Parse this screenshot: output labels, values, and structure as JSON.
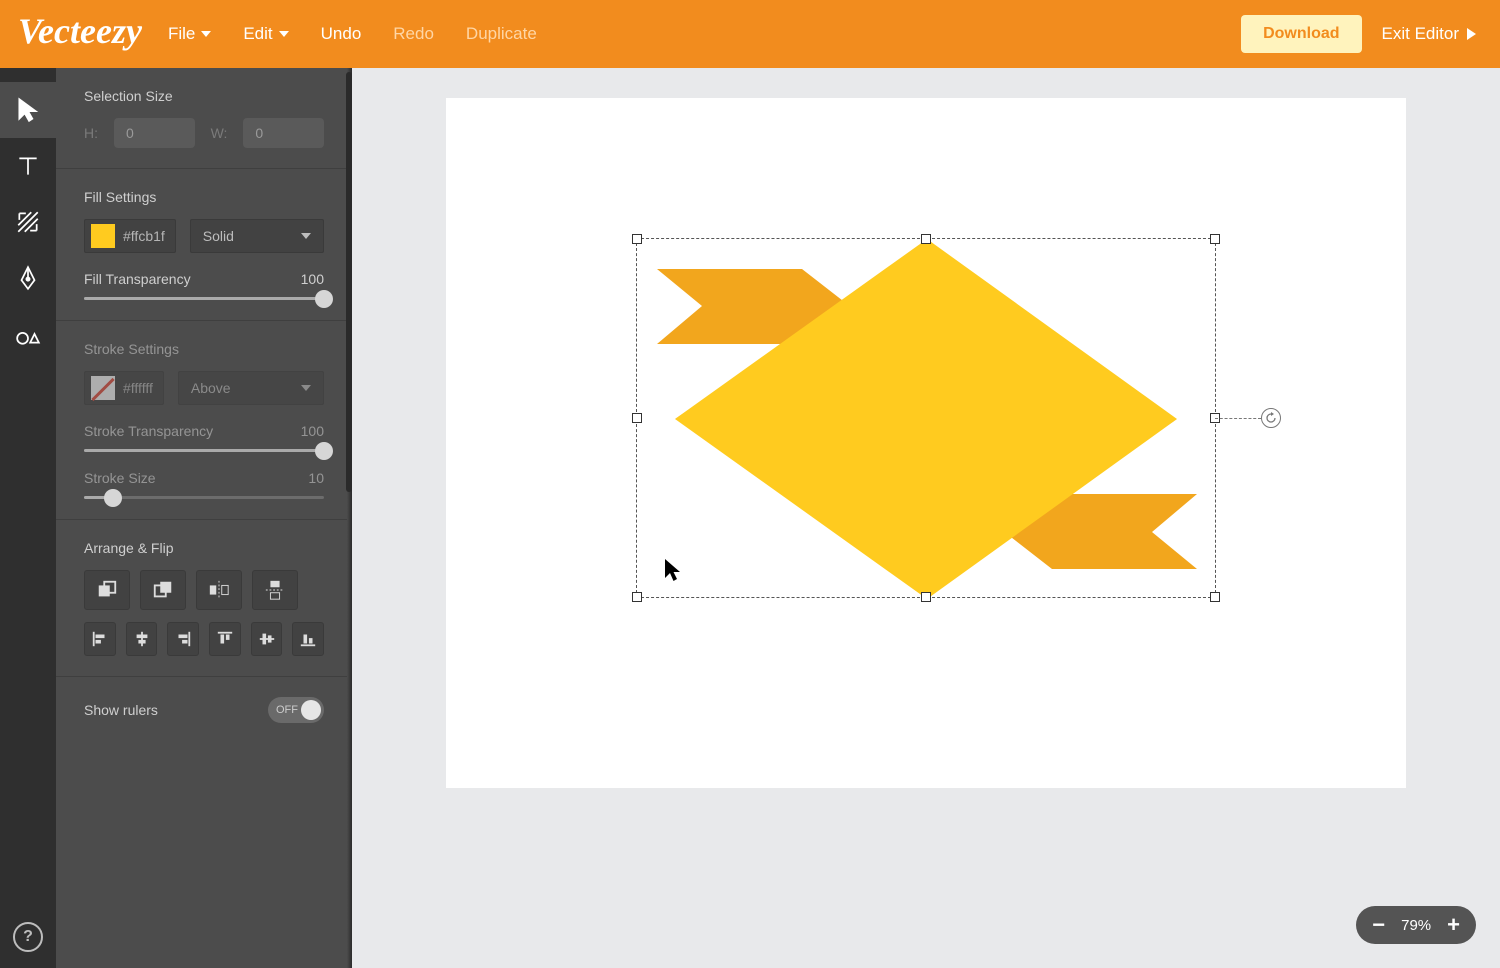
{
  "topbar": {
    "brand": "Vecteezy",
    "menu": {
      "file": "File",
      "edit": "Edit",
      "undo": "Undo",
      "redo": "Redo",
      "duplicate": "Duplicate"
    },
    "download": "Download",
    "exit": "Exit Editor"
  },
  "selection": {
    "title": "Selection Size",
    "h_label": "H:",
    "h_value": "0",
    "w_label": "W:",
    "w_value": "0"
  },
  "fill": {
    "title": "Fill Settings",
    "hex": "#ffcb1f",
    "type": "Solid",
    "transparency_label": "Fill Transparency",
    "transparency_value": "100"
  },
  "stroke": {
    "title": "Stroke Settings",
    "hex": "#ffffff",
    "position": "Above",
    "transparency_label": "Stroke Transparency",
    "transparency_value": "100",
    "size_label": "Stroke Size",
    "size_value": "10"
  },
  "arrange": {
    "title": "Arrange & Flip"
  },
  "rulers": {
    "label": "Show rulers",
    "state": "OFF"
  },
  "zoom": {
    "level": "79%"
  }
}
